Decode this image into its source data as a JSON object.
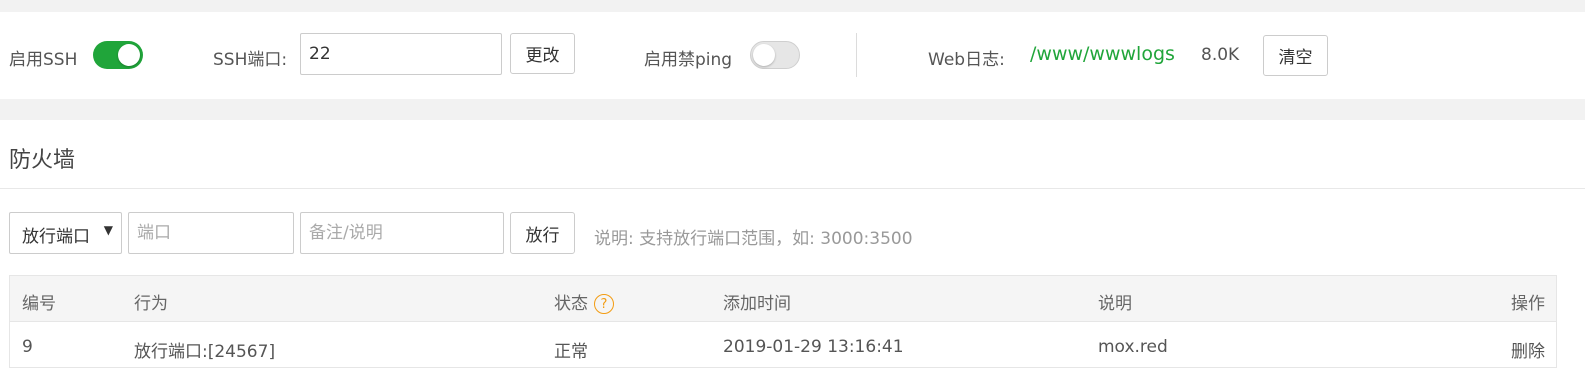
{
  "ssh": {
    "enable_label": "启用SSH",
    "enabled": true,
    "port_label": "SSH端口:",
    "port_value": "22",
    "change_button": "更改"
  },
  "ping": {
    "label": "启用禁ping",
    "enabled": false
  },
  "weblog": {
    "label": "Web日志:",
    "path": "/www/wwwlogs",
    "size": "8.0K",
    "clear_button": "清空"
  },
  "firewall": {
    "title": "防火墙",
    "select_value": "放行端口",
    "port_placeholder": "端口",
    "note_placeholder": "备注/说明",
    "allow_button": "放行",
    "hint": "说明: 支持放行端口范围，如: 3000:3500"
  },
  "table": {
    "headers": {
      "id": "编号",
      "action": "行为",
      "status": "状态",
      "status_help": "?",
      "time": "添加时间",
      "desc": "说明",
      "op": "操作"
    },
    "rows": [
      {
        "id": "9",
        "action": "放行端口:[24567]",
        "status": "正常",
        "time": "2019-01-29 13:16:41",
        "desc": "mox.red",
        "op": "删除"
      }
    ]
  },
  "colors": {
    "accent": "#20a53a",
    "help": "#f39c12",
    "background": "#f2f2f2"
  }
}
